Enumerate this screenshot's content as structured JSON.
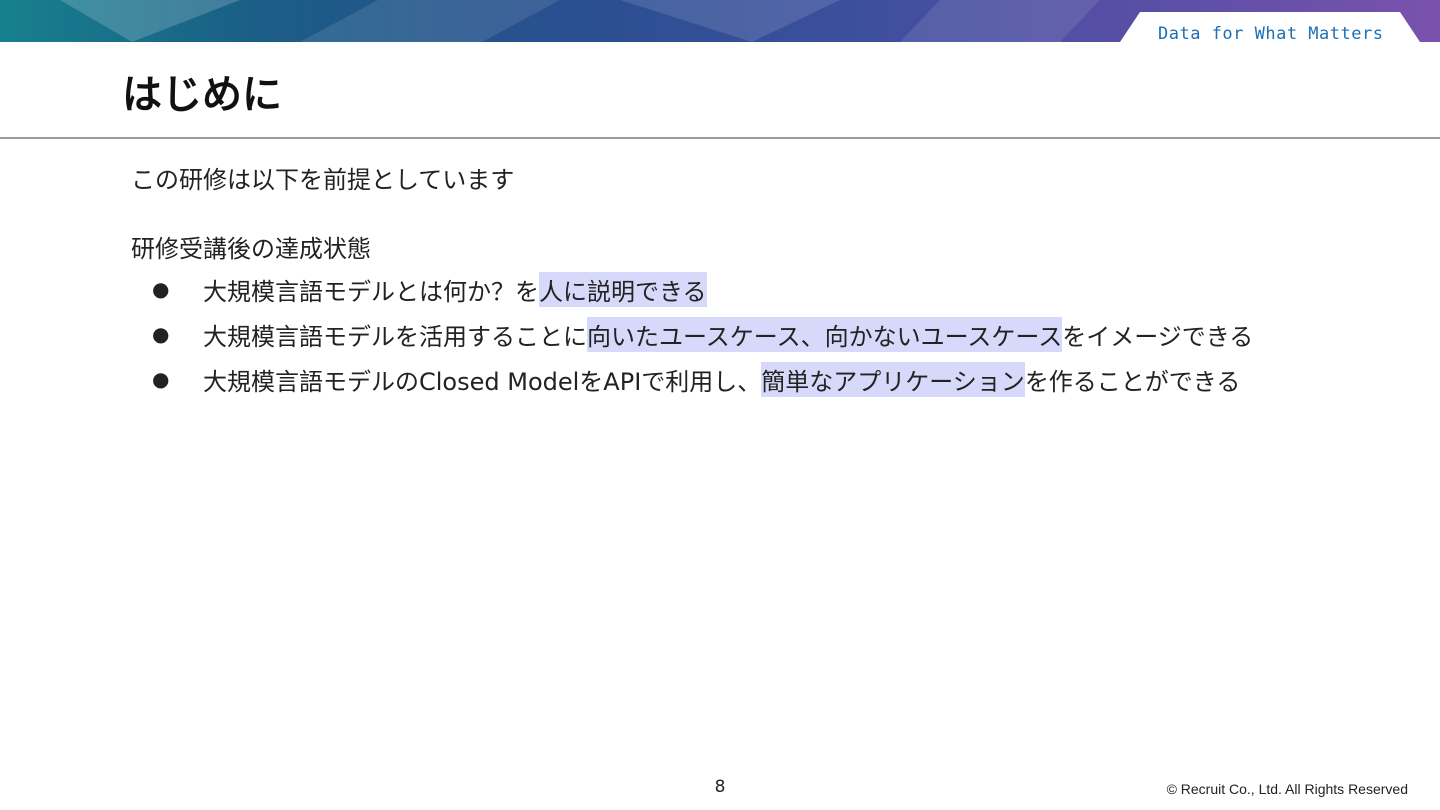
{
  "header": {
    "tagline": "Data for What Matters"
  },
  "slide": {
    "title": "はじめに",
    "intro": "この研修は以下を前提としています",
    "goals_heading": "研修受講後の達成状態",
    "bullet_glyph": "●",
    "goals": [
      {
        "before": "大規模言語モデルとは何か？を",
        "highlight": "人に説明できる",
        "after": ""
      },
      {
        "before": "大規模言語モデルを活用することに",
        "highlight": "向いたユースケース、向かないユースケース",
        "after": "をイメージできる"
      },
      {
        "before": "大規模言語モデルのClosed ModelをAPIで利用し、",
        "highlight": "簡単なアプリケーション",
        "after": "を作ることができる"
      }
    ]
  },
  "footer": {
    "page_number": "8",
    "copyright": "© Recruit Co., Ltd. All Rights Reserved"
  },
  "colors": {
    "highlight": "#d7d9fb",
    "tagline": "#1b6fb5",
    "rule": "#9a9a9a"
  }
}
